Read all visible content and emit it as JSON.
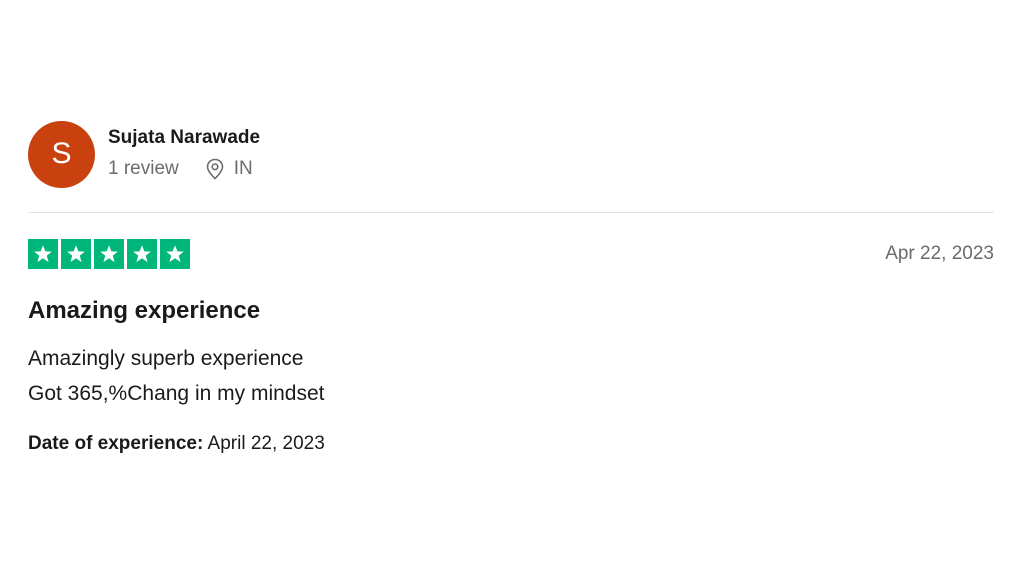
{
  "reviewer": {
    "avatar_initial": "S",
    "avatar_color": "#c8410f",
    "name": "Sujata Narawade",
    "review_count": "1 review",
    "location_icon": "location-pin-icon",
    "country": "IN"
  },
  "review": {
    "rating": 5,
    "rating_max": 5,
    "star_color": "#00b67a",
    "date": "Apr 22, 2023",
    "title": "Amazing experience",
    "body_lines": [
      "Amazingly superb experience",
      "Got 365,%Chang in my mindset"
    ],
    "experience_label": "Date of experience:",
    "experience_date": "April 22, 2023"
  }
}
